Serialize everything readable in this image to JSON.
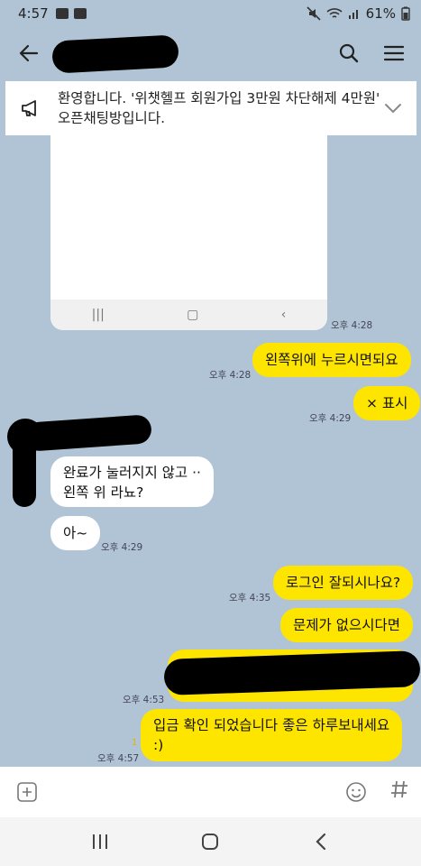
{
  "status_bar": {
    "time": "4:57",
    "battery": "61%"
  },
  "notice": {
    "text": "환영합니다. '위챗헬프 회원가입 3만원 차단해제 4만원' 오픈채팅방입니다."
  },
  "image_message": {
    "time": "오후 4:28"
  },
  "messages": [
    {
      "id": "m1",
      "side": "me",
      "text": "왼쪽위에 누르시면되요",
      "time": "오후 4:28"
    },
    {
      "id": "m2",
      "side": "me",
      "text": "× 표시",
      "time": "오후 4:29"
    },
    {
      "id": "m3",
      "side": "them",
      "line1": "완료가 눌러지지 않고 ··",
      "line2": "왼쪽 위 라뇨?"
    },
    {
      "id": "m4",
      "side": "them",
      "text": "아~",
      "time": "오후 4:29"
    },
    {
      "id": "m5",
      "side": "me",
      "text": "로그인 잘되시나요?",
      "time": "오후 4:35"
    },
    {
      "id": "m6",
      "side": "me",
      "text": "문제가 없으시다면"
    },
    {
      "id": "m7",
      "side": "me",
      "text": "",
      "time": "오후 4:53"
    },
    {
      "id": "m8",
      "side": "me",
      "line1": "입금 확인 되었습니다 좋은 하루보내세요",
      "line2": ":)",
      "time": "오후 4:57",
      "unread": "1"
    }
  ],
  "colors": {
    "chat_bg": "#b1c4d6",
    "my_bubble": "#fee500",
    "their_bubble": "#ffffff"
  },
  "icons": [
    "back-arrow-icon",
    "search-icon",
    "menu-icon",
    "megaphone-icon",
    "chevron-down-icon",
    "plus-box-icon",
    "emoji-icon",
    "hash-icon"
  ]
}
